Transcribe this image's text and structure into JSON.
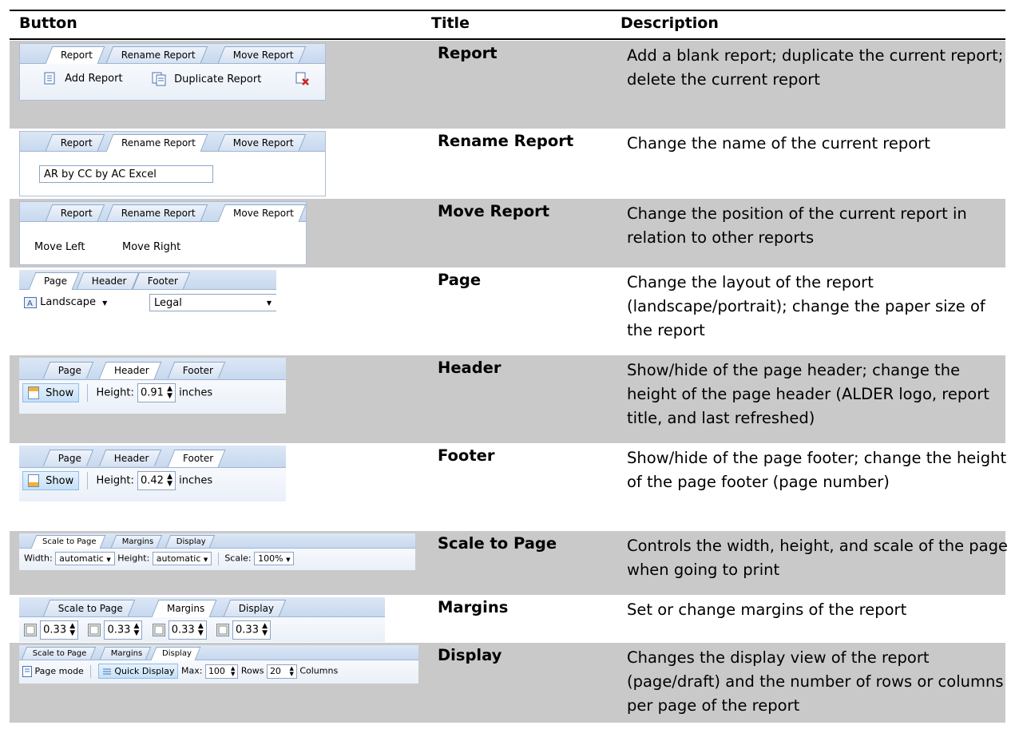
{
  "headers": {
    "button": "Button",
    "title": "Title",
    "description": "Description"
  },
  "rows": [
    {
      "title": "Report",
      "description": "Add a blank report; duplicate the current report; delete the current report",
      "ribbon": {
        "tabs": [
          "Report",
          "Rename Report",
          "Move Report"
        ],
        "active": 0,
        "controls": {
          "add": "Add Report",
          "duplicate": "Duplicate Report"
        }
      }
    },
    {
      "title": "Rename Report",
      "description": "Change the name of the current report",
      "ribbon": {
        "tabs": [
          "Report",
          "Rename Report",
          "Move Report"
        ],
        "active": 1,
        "controls": {
          "name_value": "AR by CC by AC Excel"
        }
      }
    },
    {
      "title": "Move Report",
      "description": "Change the position of the current report in relation to other reports",
      "ribbon": {
        "tabs": [
          "Report",
          "Rename Report",
          "Move Report"
        ],
        "active": 2,
        "controls": {
          "left": "Move Left",
          "right": "Move Right"
        }
      }
    },
    {
      "title": "Page",
      "description": "Change the layout of the report (landscape/portrait); change the paper size of the report",
      "ribbon": {
        "tabs": [
          "Page",
          "Header",
          "Footer"
        ],
        "active": 0,
        "controls": {
          "orientation": "Landscape",
          "paper": "Legal"
        }
      }
    },
    {
      "title": "Header",
      "description": "Show/hide of the page header; change the height of the page header (ALDER logo, report title, and last refreshed)",
      "ribbon": {
        "tabs": [
          "Page",
          "Header",
          "Footer"
        ],
        "active": 1,
        "controls": {
          "show": "Show",
          "height_label": "Height:",
          "height_value": "0.91",
          "unit": "inches"
        }
      }
    },
    {
      "title": "Footer",
      "description": "Show/hide of the page footer; change the height of the page footer (page number)",
      "ribbon": {
        "tabs": [
          "Page",
          "Header",
          "Footer"
        ],
        "active": 2,
        "controls": {
          "show": "Show",
          "height_label": "Height:",
          "height_value": "0.42",
          "unit": "inches"
        }
      }
    },
    {
      "title": "Scale to Page",
      "description": "Controls the width, height, and scale of the page when going to print",
      "ribbon": {
        "tabs": [
          "Scale to Page",
          "Margins",
          "Display"
        ],
        "active": 0,
        "controls": {
          "width_label": "Width:",
          "width_value": "automatic",
          "height_label": "Height:",
          "height_value": "automatic",
          "scale_label": "Scale:",
          "scale_value": "100%"
        }
      }
    },
    {
      "title": "Margins",
      "description": "Set or change margins of the report",
      "ribbon": {
        "tabs": [
          "Scale to Page",
          "Margins",
          "Display"
        ],
        "active": 1,
        "controls": {
          "values": [
            "0.33",
            "0.33",
            "0.33",
            "0.33"
          ]
        }
      }
    },
    {
      "title": "Display",
      "description": "Changes the display view of the report (page/draft) and the number of rows or columns per page of the report",
      "ribbon": {
        "tabs": [
          "Scale to Page",
          "Margins",
          "Display"
        ],
        "active": 2,
        "controls": {
          "page_mode": "Page mode",
          "quick_display": "Quick Display",
          "max_label": "Max:",
          "max_value": "100",
          "rows_label": "Rows",
          "rows_value": "20",
          "columns_label": "Columns"
        }
      }
    }
  ]
}
